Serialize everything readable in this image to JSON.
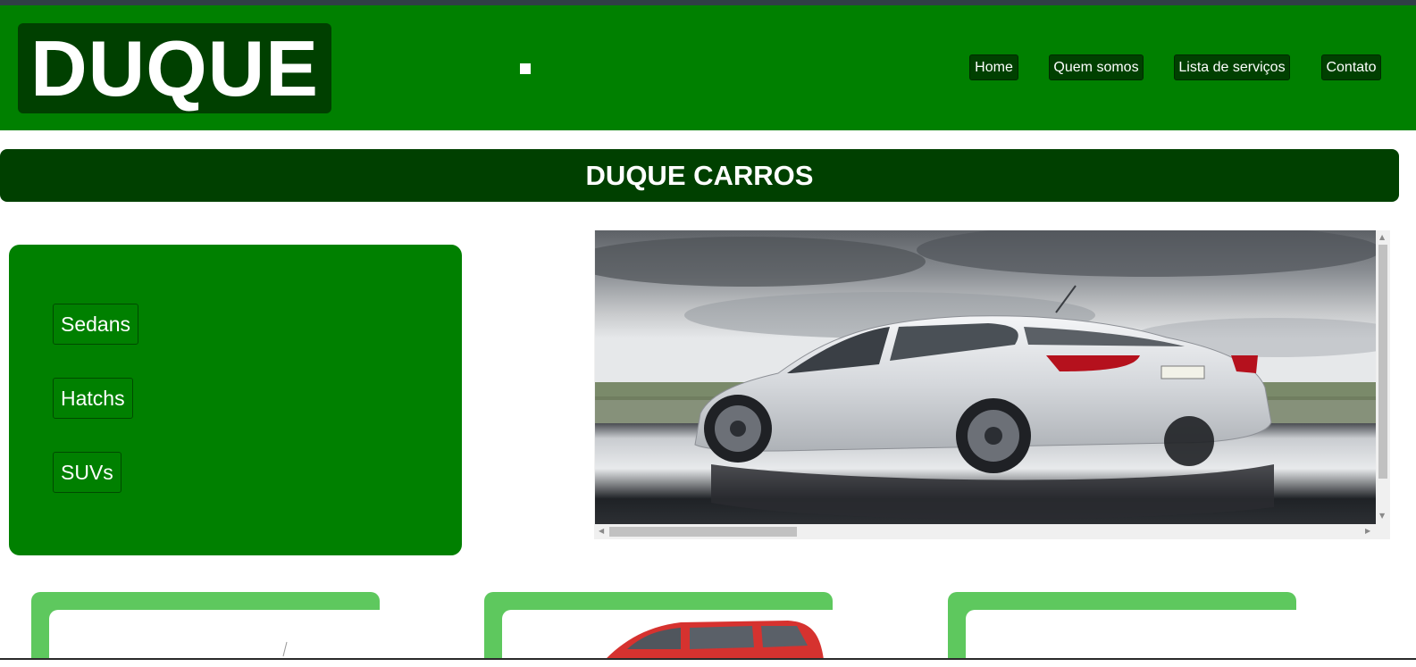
{
  "header": {
    "logo_text": "DUQUE",
    "nav": [
      {
        "label": "Home"
      },
      {
        "label": "Quem somos"
      },
      {
        "label": "Lista de serviços"
      },
      {
        "label": "Contato"
      }
    ]
  },
  "banner": {
    "title": "DUQUE CARROS"
  },
  "categories": [
    {
      "label": "Sedans"
    },
    {
      "label": "Hatchs"
    },
    {
      "label": "SUVs"
    }
  ],
  "colors": {
    "header_green": "#008000",
    "dark_green": "#004000",
    "card_green": "#5ec85e"
  },
  "icons": {
    "bullet": "square-bullet-icon",
    "scroll_up": "arrow-up-icon",
    "scroll_down": "arrow-down-icon",
    "scroll_left": "arrow-left-icon",
    "scroll_right": "arrow-right-icon"
  }
}
